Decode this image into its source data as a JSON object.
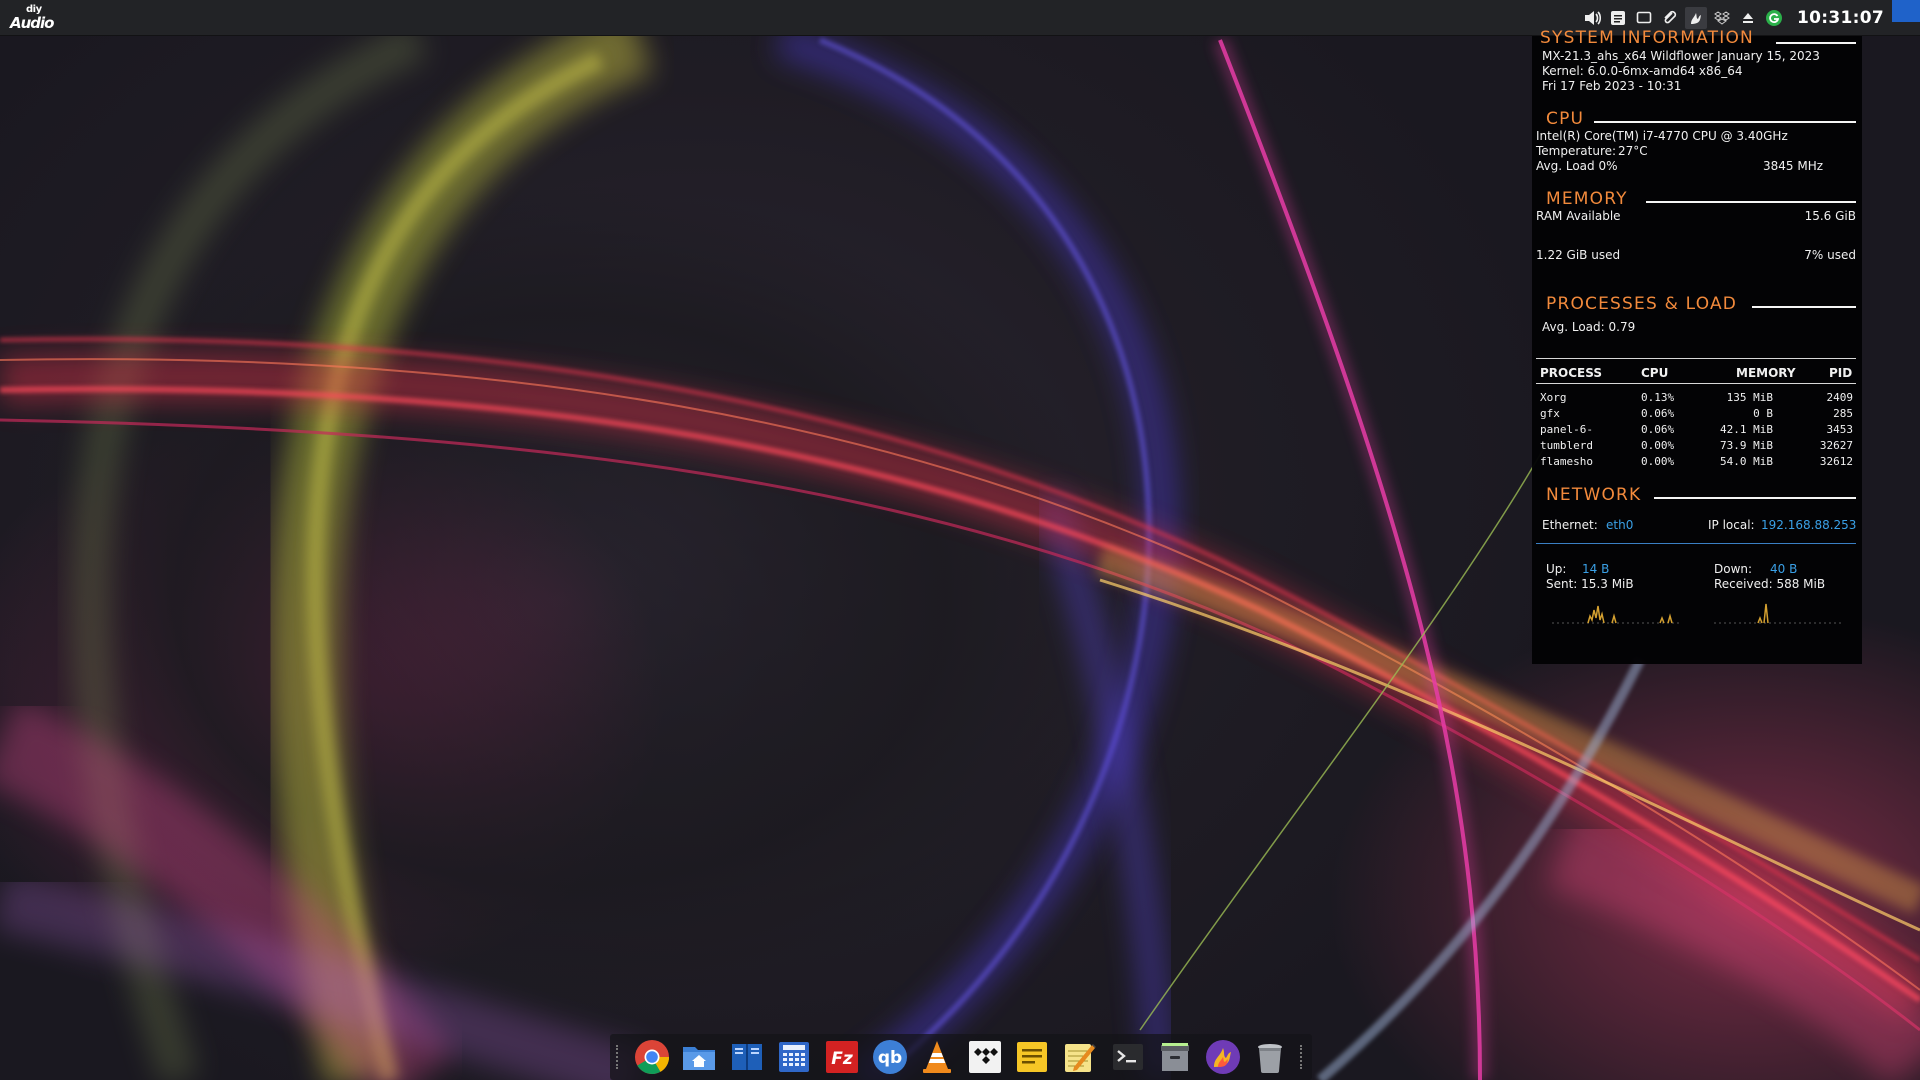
{
  "logo": {
    "line1": "diy",
    "line2": "Audio"
  },
  "top_panel": {
    "tray_icons": [
      "volume-icon",
      "notes-icon",
      "display-icon",
      "clip-icon",
      "flameshot-icon",
      "dropbox-icon",
      "eject-icon",
      "update-icon"
    ],
    "clock": "10:31:07"
  },
  "conky": {
    "system": {
      "title": "SYSTEM INFORMATION",
      "os": "MX-21.3_ahs_x64 Wildflower January 15, 2023",
      "kernel": "Kernel: 6.0.0-6mx-amd64 x86_64",
      "datetime": "Fri 17 Feb 2023 - 10:31"
    },
    "cpu": {
      "title": "CPU",
      "model": "Intel(R) Core(TM) i7-4770 CPU @ 3.40GHz",
      "temperature_label": "Temperature:",
      "temperature": "27°C",
      "load": "Avg. Load 0%",
      "freq": "3845 MHz"
    },
    "memory": {
      "title": "MEMORY",
      "ram_label": "RAM Available",
      "ram_value": "15.6 GiB",
      "used": "1.22 GiB used",
      "used_pct": "7% used"
    },
    "processes": {
      "title": "PROCESSES & LOAD",
      "avg_load": "Avg. Load: 0.79",
      "headers": [
        "PROCESS",
        "CPU",
        "MEMORY",
        "PID"
      ],
      "rows": [
        [
          "Xorg",
          "0.13%",
          "135 MiB",
          "2409"
        ],
        [
          "gfx",
          "0.06%",
          "0 B",
          "285"
        ],
        [
          "panel-6-",
          "0.06%",
          "42.1 MiB",
          "3453"
        ],
        [
          "tumblerd",
          "0.00%",
          "73.9 MiB",
          "32627"
        ],
        [
          "flamesho",
          "0.00%",
          "54.0 MiB",
          "32612"
        ]
      ]
    },
    "network": {
      "title": "NETWORK",
      "ethernet_label": "Ethernet:",
      "ethernet_value": "eth0",
      "ip_label": "IP local:",
      "ip_value": "192.168.88.253",
      "up_label": "Up:",
      "up_value": "14 B",
      "down_label": "Down:",
      "down_value": "40 B",
      "sent": "Sent: 15.3 MiB",
      "received": "Received: 588 MiB"
    }
  },
  "dock": {
    "apps": [
      "chrome-icon",
      "file-manager-icon",
      "book-reader-icon",
      "calculator-icon",
      "filezilla-icon",
      "qbittorrent-icon",
      "vlc-icon",
      "tidal-icon",
      "notes-icon",
      "text-editor-icon",
      "terminal-icon",
      "archive-icon",
      "flameshot-icon",
      "trash-icon"
    ],
    "qb_label": "qb",
    "fz_label": "Fz"
  },
  "colors": {
    "accent_orange": "#f28a3c",
    "link_blue": "#3aa0e6",
    "panel_bg": "#222326",
    "conky_bg": "#020204"
  }
}
